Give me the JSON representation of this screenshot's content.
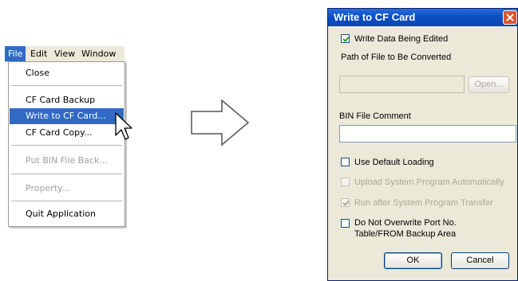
{
  "menu": {
    "bar": [
      "File",
      "Edit",
      "View",
      "Window"
    ],
    "items": [
      {
        "label": "Close",
        "state": "normal"
      },
      {
        "label": "CF Card Backup",
        "state": "normal"
      },
      {
        "label": "Write to CF Card...",
        "state": "highlighted"
      },
      {
        "label": "CF Card Copy...",
        "state": "normal"
      },
      {
        "label": "Put BIN File Back...",
        "state": "disabled"
      },
      {
        "label": "Property...",
        "state": "disabled"
      },
      {
        "label": "Quit Application",
        "state": "normal"
      }
    ]
  },
  "dialog": {
    "title": "Write to CF Card",
    "write_data_label": "Write Data Being Edited",
    "write_data_checked": true,
    "path_label": "Path of File to Be Converted",
    "path_value": "",
    "open_button": "Open...",
    "bin_comment_label": "BIN File Comment",
    "bin_comment_value": "",
    "use_default_loading": "Use Default Loading",
    "upload_system_program": "Upload System Program Automatically",
    "run_after_transfer": "Run after System Program Transfer",
    "do_not_overwrite_line1": "Do Not Overwrite Port No.",
    "do_not_overwrite_line2": "Table/FROM Backup Area",
    "ok_button": "OK",
    "cancel_button": "Cancel"
  },
  "colors": {
    "highlight": "#316ac5",
    "title_bar": "#0a4fc4",
    "close_button": "#e0532e",
    "dialog_bg": "#ece9d8"
  },
  "icons": [
    "mouse-cursor-icon",
    "right-arrow-icon",
    "close-icon",
    "checkmark-icon"
  ]
}
